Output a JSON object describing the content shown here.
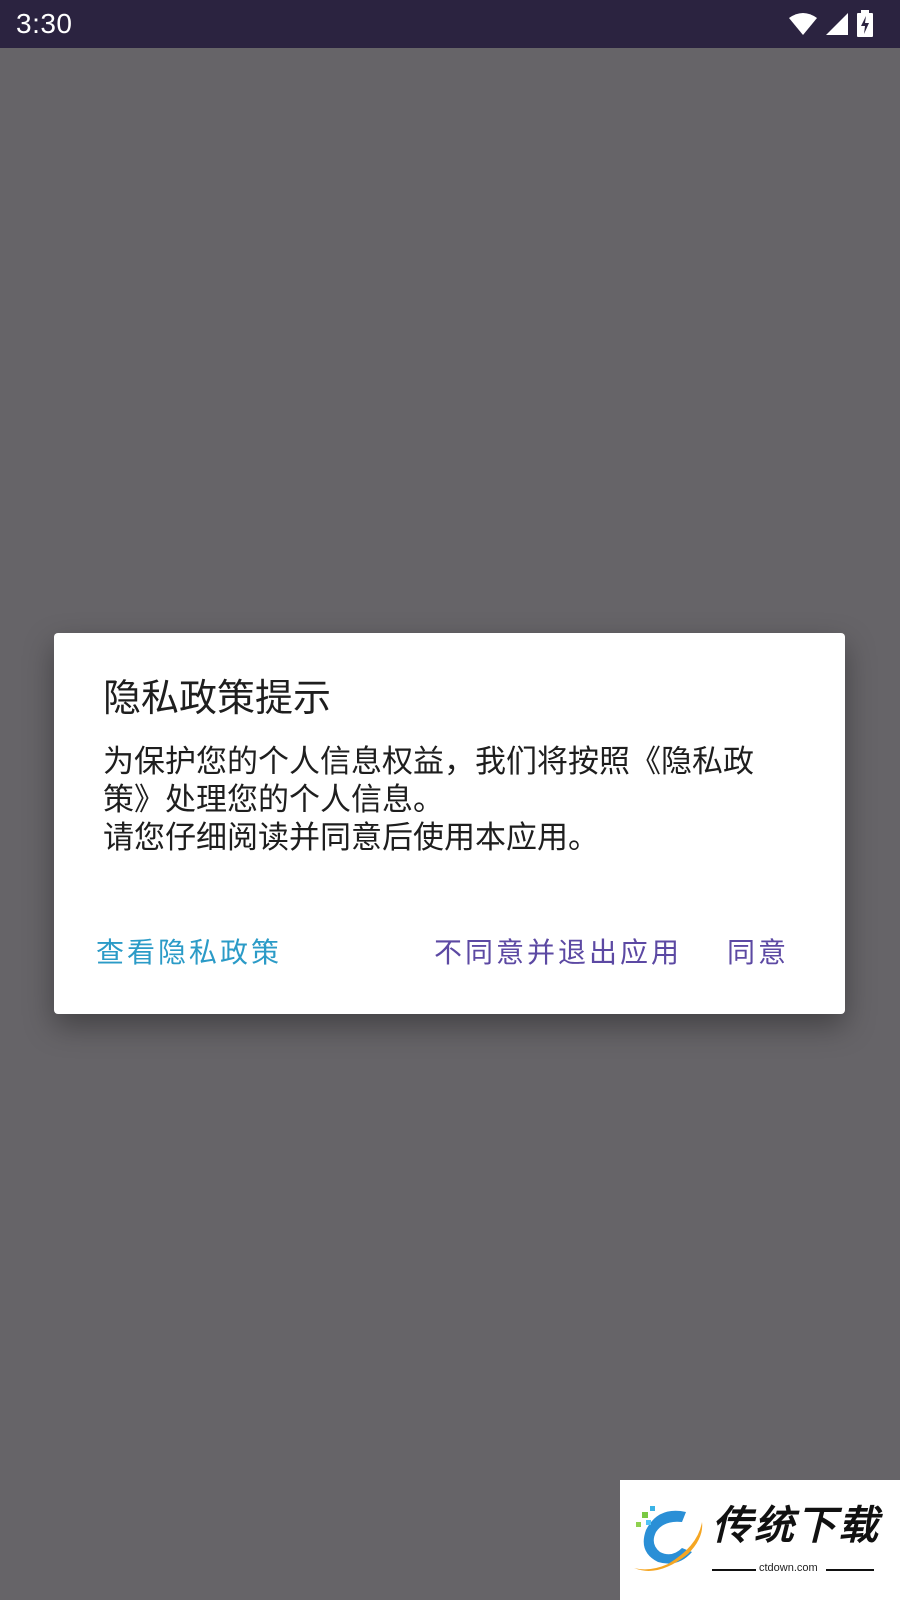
{
  "status_bar": {
    "time": "3:30",
    "icons": [
      "wifi-icon",
      "cellular-signal-icon",
      "battery-charging-icon"
    ],
    "background": "#2b2340"
  },
  "dialog": {
    "title": "隐私政策提示",
    "message_lines": [
      "为保护您的个人信息权益，我们将按照《隐私政策》处理您的个人信息。",
      "请您仔细阅读并同意后使用本应用。"
    ],
    "buttons": {
      "view_policy": "查看隐私政策",
      "disagree_exit": "不同意并退出应用",
      "agree": "同意"
    },
    "colors": {
      "view_policy": "#2b9bc7",
      "disagree_exit": "#5c49a3",
      "agree": "#5c49a3"
    }
  },
  "watermark": {
    "name": "传统下载",
    "domain": "ctdown.com"
  },
  "colors": {
    "scrim": "#666468"
  }
}
